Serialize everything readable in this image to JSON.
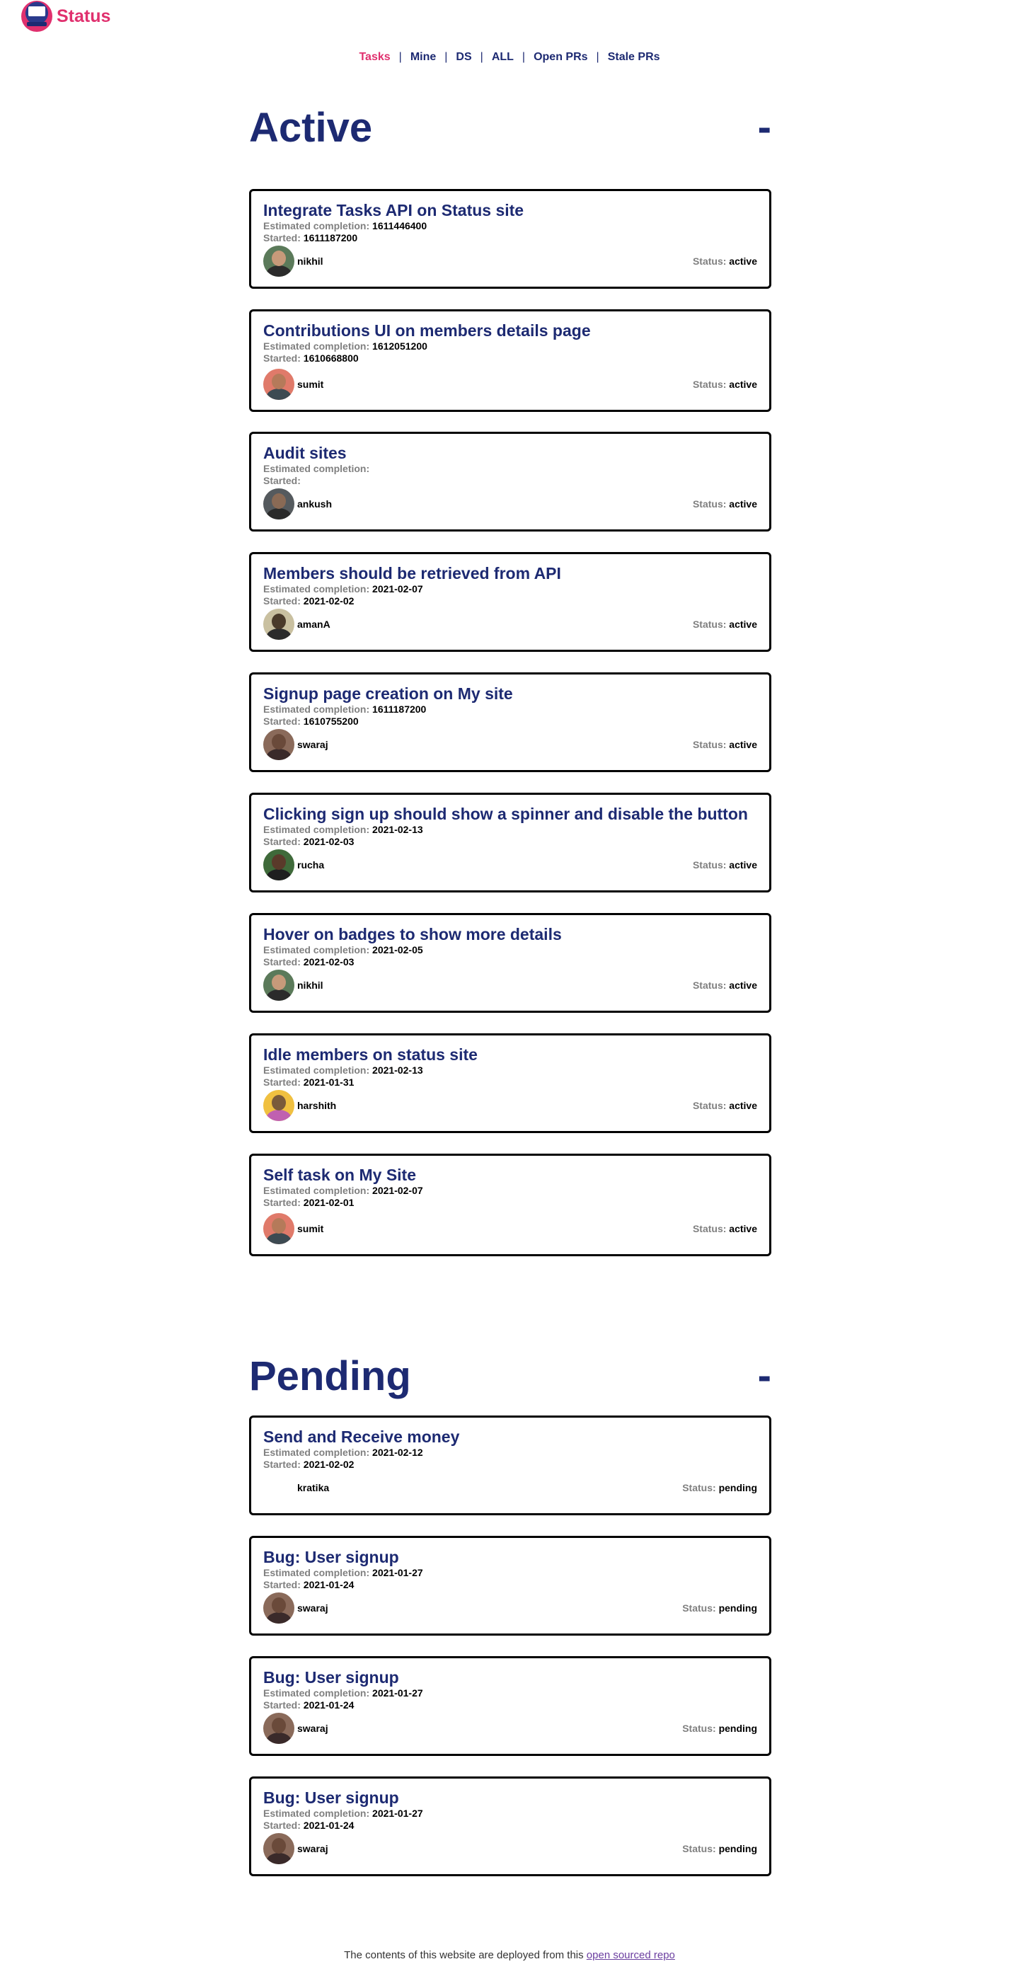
{
  "header": {
    "brand": "Status"
  },
  "nav": {
    "items": [
      {
        "label": "Tasks",
        "active": true
      },
      {
        "label": "Mine",
        "active": false
      },
      {
        "label": "DS",
        "active": false
      },
      {
        "label": "ALL",
        "active": false
      },
      {
        "label": "Open PRs",
        "active": false
      },
      {
        "label": "Stale PRs",
        "active": false
      }
    ],
    "separator": "|"
  },
  "labels": {
    "estimated": "Estimated completion: ",
    "started": "Started: ",
    "status": "Status: "
  },
  "active": {
    "title": "Active",
    "toggle": "-",
    "tasks": [
      {
        "title": "Integrate Tasks API on Status site",
        "estimated": "1611446400",
        "started": "1611187200",
        "assignee": "nikhil",
        "status": "active"
      },
      {
        "title": "Contributions UI on members details page",
        "estimated": "1612051200",
        "started": "1610668800",
        "assignee": "sumit",
        "status": "active"
      },
      {
        "title": "Audit sites",
        "estimated": "",
        "started": "",
        "assignee": "ankush",
        "status": "active"
      },
      {
        "title": "Members should be retrieved from API",
        "estimated": "2021-02-07",
        "started": "2021-02-02",
        "assignee": "amanA",
        "status": "active"
      },
      {
        "title": "Signup page creation on My site",
        "estimated": "1611187200",
        "started": "1610755200",
        "assignee": "swaraj",
        "status": "active"
      },
      {
        "title": "Clicking sign up should show a spinner and disable the button",
        "estimated": "2021-02-13",
        "started": "2021-02-03",
        "assignee": "rucha",
        "status": "active"
      },
      {
        "title": "Hover on badges to show more details",
        "estimated": "2021-02-05",
        "started": "2021-02-03",
        "assignee": "nikhil",
        "status": "active"
      },
      {
        "title": "Idle members on status site",
        "estimated": "2021-02-13",
        "started": "2021-01-31",
        "assignee": "harshith",
        "status": "active"
      },
      {
        "title": "Self task on My Site",
        "estimated": "2021-02-07",
        "started": "2021-02-01",
        "assignee": "sumit",
        "status": "active"
      }
    ]
  },
  "pending": {
    "title": "Pending",
    "toggle": "-",
    "tasks": [
      {
        "title": "Send and Receive money",
        "estimated": "2021-02-12",
        "started": "2021-02-02",
        "assignee": "kratika",
        "status": "pending"
      },
      {
        "title": "Bug: User signup",
        "estimated": "2021-01-27",
        "started": "2021-01-24",
        "assignee": "swaraj",
        "status": "pending"
      },
      {
        "title": "Bug: User signup",
        "estimated": "2021-01-27",
        "started": "2021-01-24",
        "assignee": "swaraj",
        "status": "pending"
      },
      {
        "title": "Bug: User signup",
        "estimated": "2021-01-27",
        "started": "2021-01-24",
        "assignee": "swaraj",
        "status": "pending"
      }
    ]
  },
  "footer": {
    "text": "The contents of this website are deployed from this ",
    "link": "open sourced repo"
  }
}
